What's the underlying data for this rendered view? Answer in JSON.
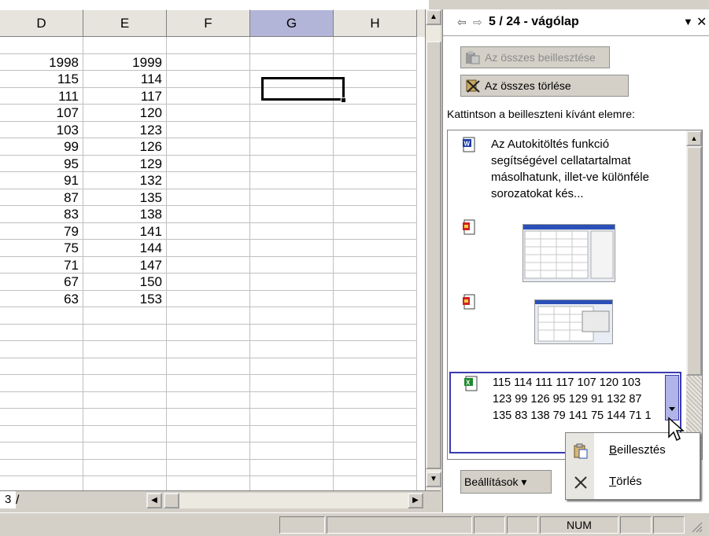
{
  "spreadsheet": {
    "columns": [
      "D",
      "E",
      "F",
      "G",
      "H"
    ],
    "selected_column": "G",
    "rows": [
      [
        "",
        "",
        "",
        "",
        ""
      ],
      [
        "1998",
        "1999",
        "",
        "",
        ""
      ],
      [
        "115",
        "114",
        "",
        "",
        ""
      ],
      [
        "111",
        "117",
        "",
        "",
        ""
      ],
      [
        "107",
        "120",
        "",
        "",
        ""
      ],
      [
        "103",
        "123",
        "",
        "",
        ""
      ],
      [
        "99",
        "126",
        "",
        "",
        ""
      ],
      [
        "95",
        "129",
        "",
        "",
        ""
      ],
      [
        "91",
        "132",
        "",
        "",
        ""
      ],
      [
        "87",
        "135",
        "",
        "",
        ""
      ],
      [
        "83",
        "138",
        "",
        "",
        ""
      ],
      [
        "79",
        "141",
        "",
        "",
        ""
      ],
      [
        "75",
        "144",
        "",
        "",
        ""
      ],
      [
        "71",
        "147",
        "",
        "",
        ""
      ],
      [
        "67",
        "150",
        "",
        "",
        ""
      ],
      [
        "63",
        "153",
        "",
        "",
        ""
      ],
      [
        "",
        "",
        "",
        "",
        ""
      ],
      [
        "",
        "",
        "",
        "",
        ""
      ],
      [
        "",
        "",
        "",
        "",
        ""
      ],
      [
        "",
        "",
        "",
        "",
        ""
      ],
      [
        "",
        "",
        "",
        "",
        ""
      ],
      [
        "",
        "",
        "",
        "",
        ""
      ],
      [
        "",
        "",
        "",
        "",
        ""
      ],
      [
        "",
        "",
        "",
        "",
        ""
      ],
      [
        "",
        "",
        "",
        "",
        ""
      ],
      [
        "",
        "",
        "",
        "",
        ""
      ],
      [
        "",
        "",
        "",
        "",
        ""
      ],
      [
        "",
        "",
        "",
        "",
        ""
      ]
    ],
    "sheet_tab": "3",
    "tab_separator": "/"
  },
  "task_pane": {
    "back_glyph": "⇦",
    "forward_glyph": "⇨",
    "title": "5 / 24 - vágólap",
    "menu_glyph": "▼",
    "close_glyph": "✕",
    "paste_all_label": "Az összes beillesztése",
    "clear_all_label": "Az összes törlése",
    "instruction": "Kattintson a beilleszteni kívánt elemre:",
    "clip_items": [
      {
        "type": "word",
        "text": "Az Autokitöltés funkció segítségével cellatartalmat másolhatunk, illet-ve különféle sorozatokat kés..."
      },
      {
        "type": "image",
        "text": ""
      },
      {
        "type": "image",
        "text": ""
      },
      {
        "type": "excel",
        "text": "115 114 111 117 107 120 103 123 99 126 95 129 91 132 87 135 83 138 79 141 75 144 71 1"
      }
    ],
    "settings_label": "Beállítások ▾",
    "colors": {
      "selection_border": "#3a3ab0",
      "selection_fill": "#b0b4e8"
    }
  },
  "context_menu": {
    "items": [
      {
        "label": "Beillesztés",
        "icon": "clipboard-paste-icon"
      },
      {
        "label": "Törlés",
        "icon": "x-delete-icon"
      }
    ]
  },
  "status_bar": {
    "num_indicator": "NUM"
  }
}
